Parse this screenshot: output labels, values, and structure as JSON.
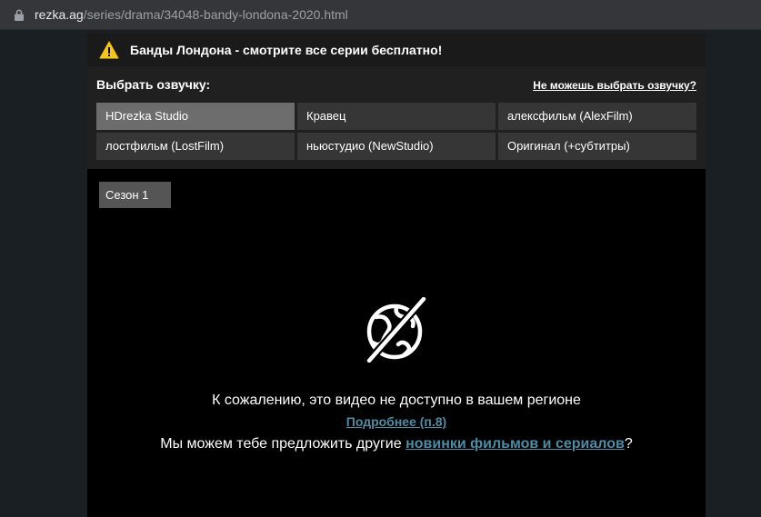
{
  "browser": {
    "url_host": "rezka.ag",
    "url_path": "/series/drama/34048-bandy-londona-2020.html"
  },
  "warning": {
    "text": "Банды Лондона - смотрите все серии бесплатно!"
  },
  "voice": {
    "title": "Выбрать озвучку:",
    "help_link": "Не можешь выбрать озвучку?",
    "options": [
      {
        "label": "HDrezka Studio",
        "active": true
      },
      {
        "label": "Кравец",
        "active": false
      },
      {
        "label": "алексфильм (AlexFilm)",
        "active": false
      },
      {
        "label": "лостфильм (LostFilm)",
        "active": false
      },
      {
        "label": "ньюстудио (NewStudio)",
        "active": false
      },
      {
        "label": "Оригинал (+субтитры)",
        "active": false
      }
    ]
  },
  "season": {
    "label": "Сезон 1"
  },
  "message": {
    "line1": "К сожалению, это видео не доступно в вашем регионе",
    "details_link": "Подробнее (п.8)",
    "line3_prefix": "Мы можем тебе предложить другие ",
    "line3_link": "новинки фильмов и сериалов",
    "line3_suffix": "?"
  },
  "icons": {
    "lock": "lock-icon",
    "warning": "warning-triangle-icon",
    "region": "globe-crossed-icon"
  },
  "colors": {
    "accent_link": "#4c8ca5",
    "warning_yellow": "#f5c518",
    "active_voice": "#6d6d6d"
  }
}
